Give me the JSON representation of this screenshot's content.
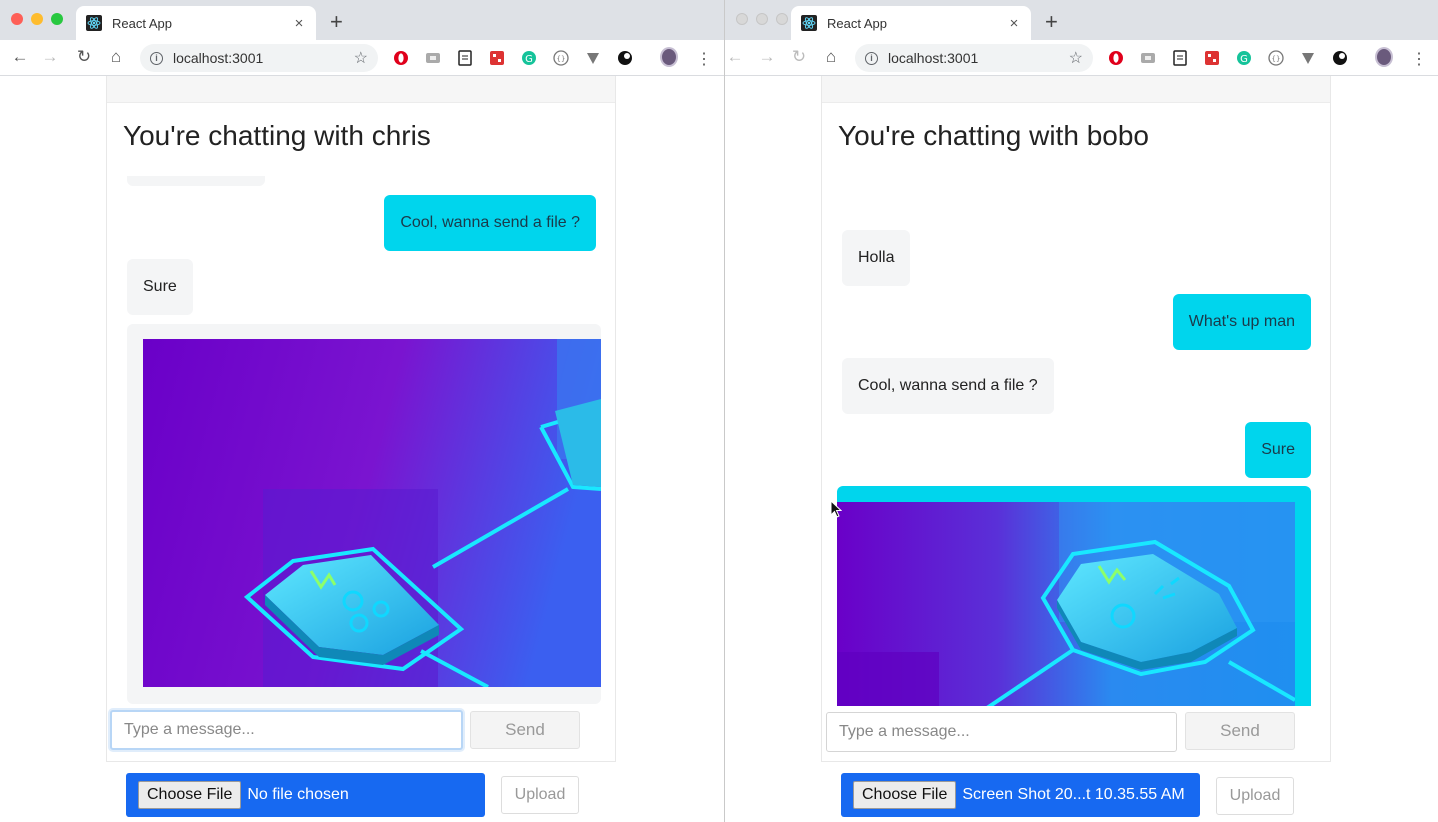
{
  "windows": [
    {
      "tab_title": "React App",
      "url": "localhost:3001",
      "chat_title": "You're chatting with chris",
      "messages": [
        {
          "text": "Cool, wanna send a file ?",
          "side": "out"
        },
        {
          "text": "Sure",
          "side": "in"
        }
      ],
      "input_placeholder": "Type a message...",
      "send_label": "Send",
      "choose_file_label": "Choose File",
      "file_status": "No file chosen",
      "upload_label": "Upload"
    },
    {
      "tab_title": "React App",
      "url": "localhost:3001",
      "chat_title": "You're chatting with bobo",
      "messages": [
        {
          "text": "Holla",
          "side": "in"
        },
        {
          "text": "What's up man",
          "side": "out"
        },
        {
          "text": "Cool, wanna send a file ?",
          "side": "in"
        },
        {
          "text": "Sure",
          "side": "out"
        }
      ],
      "input_placeholder": "Type a message...",
      "send_label": "Send",
      "choose_file_label": "Choose File",
      "file_status": "Screen Shot 20...t 10.35.55 AM",
      "upload_label": "Upload"
    }
  ],
  "icons": {
    "close": "×",
    "new_tab": "+",
    "back": "←",
    "forward": "→",
    "reload": "↻",
    "home": "⌂",
    "star": "☆",
    "menu": "⋮",
    "info": "i"
  },
  "colors": {
    "outgoing_bubble": "#00d5ed",
    "incoming_bubble": "#f4f5f6",
    "file_bar": "#1769f1",
    "image_purple": "#6a00c8",
    "image_blue": "#1f8ff0"
  }
}
